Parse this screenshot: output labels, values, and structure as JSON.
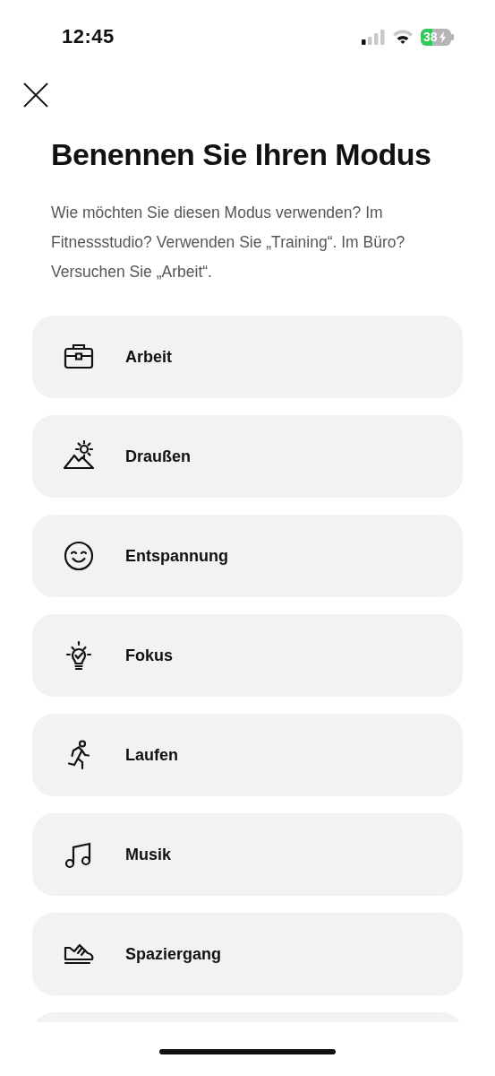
{
  "status_bar": {
    "time": "12:45",
    "battery": "38"
  },
  "title": "Benennen Sie Ihren Modus",
  "description": "Wie möchten Sie diesen Modus verwenden? Im Fitnessstudio? Verwenden Sie „Training“. Im Büro? Versuchen Sie „Arbeit“.",
  "modes": [
    {
      "label": "Arbeit",
      "kind": "briefcase"
    },
    {
      "label": "Draußen",
      "kind": "outdoors"
    },
    {
      "label": "Entspannung",
      "kind": "smile"
    },
    {
      "label": "Fokus",
      "kind": "bulb"
    },
    {
      "label": "Laufen",
      "kind": "runner"
    },
    {
      "label": "Musik",
      "kind": "music"
    },
    {
      "label": "Spaziergang",
      "kind": "shoe"
    }
  ]
}
